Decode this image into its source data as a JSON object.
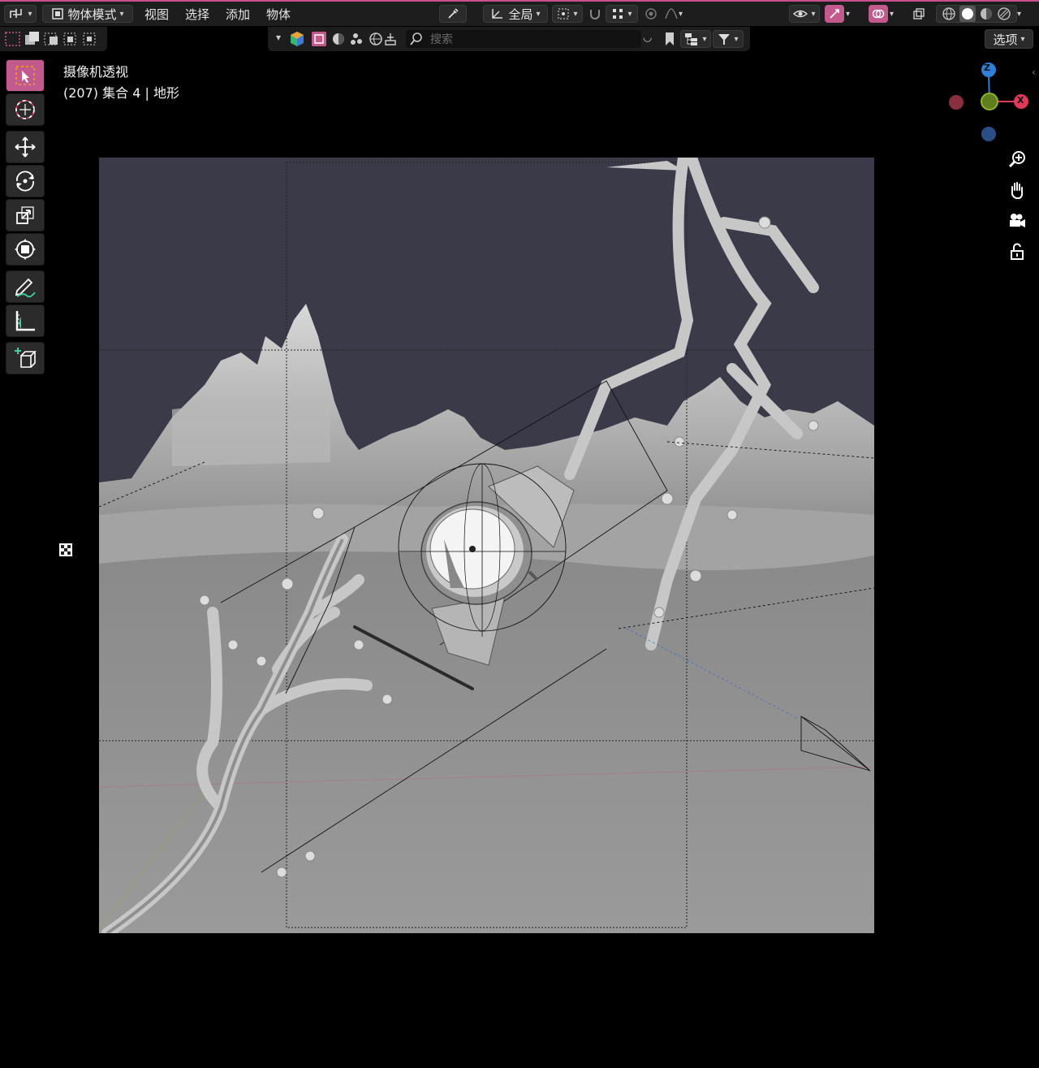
{
  "header": {
    "editor_type_icon": "editor-type-icon",
    "mode_label": "物体模式",
    "menus": [
      "视图",
      "选择",
      "添加",
      "物体"
    ],
    "transform_orientation": "全局",
    "options_label": "选项"
  },
  "outliner_bar": {
    "search_placeholder": "搜索"
  },
  "viewport": {
    "view_name": "摄像机透视",
    "collection_info": "(207) 集合 4 | 地形"
  },
  "gizmo": {
    "axes": [
      "Z",
      "X"
    ]
  },
  "colors": {
    "accent": "#c35a8e",
    "x_axis": "#e0395a",
    "y_axis": "#8bb52b",
    "z_axis": "#2f7ed8"
  }
}
